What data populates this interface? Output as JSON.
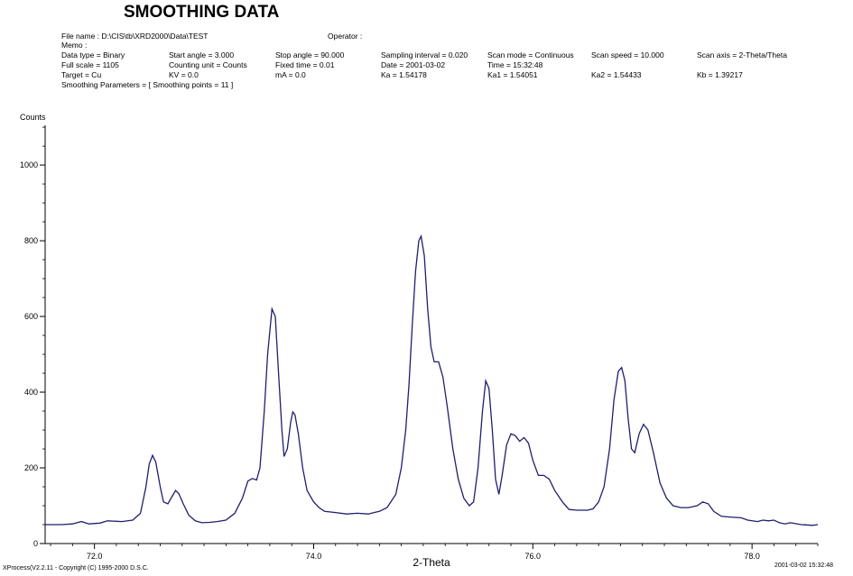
{
  "header": {
    "title": "SMOOTHING DATA",
    "rows": [
      [
        {
          "text": "File name : D:\\CIS\\tb\\XRD2000\\Data\\TEST",
          "x": 68
        },
        {
          "text": "Operator :",
          "x": 363
        }
      ],
      [
        {
          "text": "Memo :",
          "x": 68
        }
      ],
      [
        {
          "text": "Data type = Binary",
          "x": 68
        },
        {
          "text": "Start angle = 3.000",
          "x": 187
        },
        {
          "text": "Stop angle = 90.000",
          "x": 305
        },
        {
          "text": "Sampling interval = 0.020",
          "x": 422
        },
        {
          "text": "Scan mode = Continuous",
          "x": 540
        },
        {
          "text": "Scan speed = 10.000",
          "x": 655
        },
        {
          "text": "Scan axis = 2-Theta/Theta",
          "x": 772
        }
      ],
      [
        {
          "text": "Full scale = 1105",
          "x": 68
        },
        {
          "text": "Counting unit = Counts",
          "x": 187
        },
        {
          "text": "Fixed time = 0.01",
          "x": 305
        },
        {
          "text": "Date = 2001-03-02",
          "x": 422
        },
        {
          "text": "Time = 15:32:48",
          "x": 540
        }
      ],
      [
        {
          "text": "Target = Cu",
          "x": 68
        },
        {
          "text": "KV = 0.0",
          "x": 187
        },
        {
          "text": "mA = 0.0",
          "x": 305
        },
        {
          "text": "Ka = 1.54178",
          "x": 422
        },
        {
          "text": "Ka1 = 1.54051",
          "x": 540
        },
        {
          "text": "Ka2 = 1.54433",
          "x": 655
        },
        {
          "text": "Kb = 1.39217",
          "x": 772
        }
      ],
      [
        {
          "text": "Smoothing Parameters = [ Smoothing points = 11 ]",
          "x": 68
        }
      ]
    ]
  },
  "footer": {
    "left": "XProcess(V2.2.11 - Copyright (C) 1995-2000 D.S.C.",
    "right": "2001-03-02 15:32:48"
  },
  "chart_data": {
    "type": "line",
    "ylabel": "Counts",
    "xlabel": "2-Theta",
    "xlim": [
      71.55,
      78.6
    ],
    "ylim": [
      0,
      1105
    ],
    "xticks": [
      72.0,
      74.0,
      76.0,
      78.0
    ],
    "xtick_labels": [
      "72.0",
      "74.0",
      "76.0",
      "78.0"
    ],
    "yticks": [
      0,
      200,
      400,
      600,
      800,
      1000
    ],
    "ytick_labels": [
      "0",
      "200",
      "400",
      "600",
      "800",
      "1000"
    ],
    "line_color": "#1f1f6e",
    "series": [
      {
        "points": [
          [
            71.55,
            50
          ],
          [
            71.7,
            50
          ],
          [
            71.8,
            52
          ],
          [
            71.88,
            58
          ],
          [
            71.95,
            52
          ],
          [
            72.05,
            54
          ],
          [
            72.12,
            60
          ],
          [
            72.25,
            58
          ],
          [
            72.35,
            62
          ],
          [
            72.42,
            80
          ],
          [
            72.47,
            150
          ],
          [
            72.5,
            210
          ],
          [
            72.53,
            233
          ],
          [
            72.56,
            215
          ],
          [
            72.6,
            150
          ],
          [
            72.63,
            110
          ],
          [
            72.67,
            105
          ],
          [
            72.71,
            125
          ],
          [
            72.74,
            140
          ],
          [
            72.77,
            132
          ],
          [
            72.81,
            105
          ],
          [
            72.86,
            75
          ],
          [
            72.92,
            60
          ],
          [
            72.98,
            55
          ],
          [
            73.05,
            56
          ],
          [
            73.12,
            58
          ],
          [
            73.2,
            62
          ],
          [
            73.28,
            80
          ],
          [
            73.35,
            120
          ],
          [
            73.4,
            165
          ],
          [
            73.44,
            172
          ],
          [
            73.48,
            168
          ],
          [
            73.51,
            200
          ],
          [
            73.55,
            350
          ],
          [
            73.58,
            500
          ],
          [
            73.62,
            620
          ],
          [
            73.65,
            600
          ],
          [
            73.68,
            450
          ],
          [
            73.71,
            300
          ],
          [
            73.73,
            230
          ],
          [
            73.76,
            250
          ],
          [
            73.79,
            320
          ],
          [
            73.81,
            348
          ],
          [
            73.83,
            340
          ],
          [
            73.86,
            290
          ],
          [
            73.9,
            200
          ],
          [
            73.94,
            140
          ],
          [
            74.0,
            110
          ],
          [
            74.05,
            95
          ],
          [
            74.1,
            85
          ],
          [
            74.2,
            82
          ],
          [
            74.3,
            78
          ],
          [
            74.4,
            80
          ],
          [
            74.5,
            78
          ],
          [
            74.55,
            82
          ],
          [
            74.6,
            85
          ],
          [
            74.67,
            95
          ],
          [
            74.75,
            130
          ],
          [
            74.8,
            200
          ],
          [
            74.84,
            300
          ],
          [
            74.87,
            420
          ],
          [
            74.9,
            580
          ],
          [
            74.93,
            720
          ],
          [
            74.96,
            800
          ],
          [
            74.98,
            812
          ],
          [
            75.01,
            760
          ],
          [
            75.04,
            620
          ],
          [
            75.07,
            520
          ],
          [
            75.1,
            480
          ],
          [
            75.14,
            480
          ],
          [
            75.18,
            440
          ],
          [
            75.22,
            360
          ],
          [
            75.27,
            250
          ],
          [
            75.32,
            170
          ],
          [
            75.37,
            120
          ],
          [
            75.42,
            100
          ],
          [
            75.46,
            110
          ],
          [
            75.5,
            200
          ],
          [
            75.54,
            350
          ],
          [
            75.57,
            430
          ],
          [
            75.6,
            410
          ],
          [
            75.63,
            300
          ],
          [
            75.66,
            170
          ],
          [
            75.69,
            130
          ],
          [
            75.72,
            180
          ],
          [
            75.76,
            260
          ],
          [
            75.8,
            290
          ],
          [
            75.84,
            285
          ],
          [
            75.88,
            270
          ],
          [
            75.92,
            280
          ],
          [
            75.96,
            265
          ],
          [
            76.0,
            220
          ],
          [
            76.05,
            180
          ],
          [
            76.1,
            180
          ],
          [
            76.15,
            170
          ],
          [
            76.2,
            140
          ],
          [
            76.27,
            110
          ],
          [
            76.33,
            90
          ],
          [
            76.4,
            88
          ],
          [
            76.5,
            88
          ],
          [
            76.55,
            92
          ],
          [
            76.6,
            110
          ],
          [
            76.65,
            150
          ],
          [
            76.7,
            250
          ],
          [
            76.74,
            380
          ],
          [
            76.78,
            455
          ],
          [
            76.81,
            465
          ],
          [
            76.84,
            430
          ],
          [
            76.87,
            330
          ],
          [
            76.9,
            250
          ],
          [
            76.93,
            240
          ],
          [
            76.97,
            290
          ],
          [
            77.01,
            315
          ],
          [
            77.05,
            300
          ],
          [
            77.1,
            240
          ],
          [
            77.16,
            160
          ],
          [
            77.22,
            120
          ],
          [
            77.28,
            100
          ],
          [
            77.35,
            95
          ],
          [
            77.42,
            95
          ],
          [
            77.5,
            100
          ],
          [
            77.55,
            110
          ],
          [
            77.6,
            105
          ],
          [
            77.65,
            85
          ],
          [
            77.72,
            72
          ],
          [
            77.8,
            70
          ],
          [
            77.9,
            68
          ],
          [
            77.96,
            62
          ],
          [
            78.05,
            58
          ],
          [
            78.1,
            62
          ],
          [
            78.15,
            60
          ],
          [
            78.2,
            62
          ],
          [
            78.25,
            55
          ],
          [
            78.3,
            52
          ],
          [
            78.35,
            55
          ],
          [
            78.45,
            50
          ],
          [
            78.55,
            48
          ],
          [
            78.6,
            50
          ]
        ]
      }
    ]
  }
}
